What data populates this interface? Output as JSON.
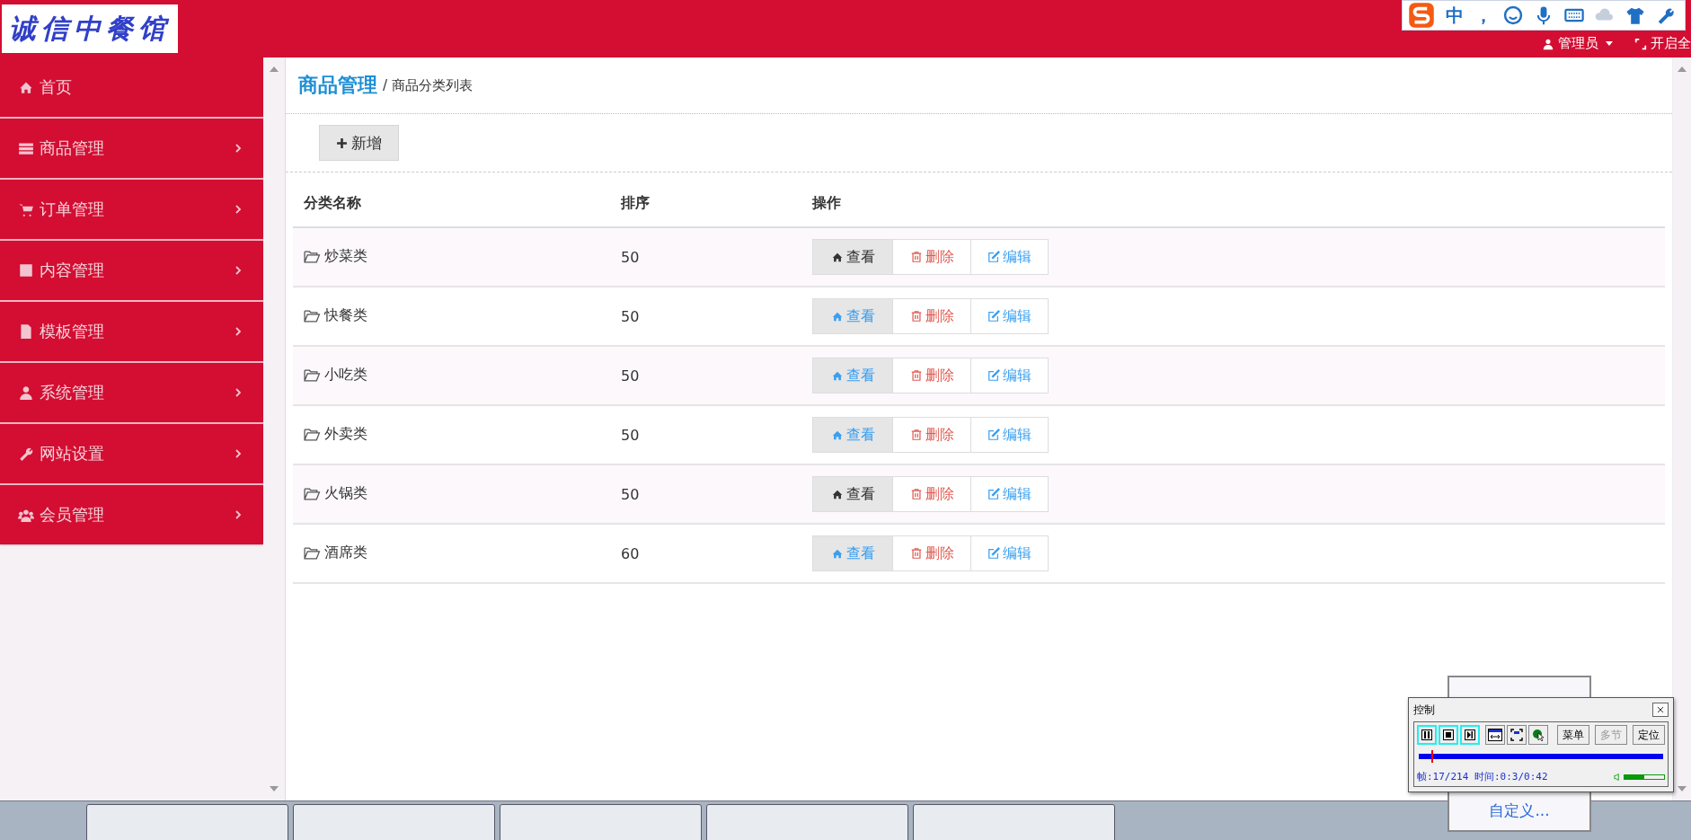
{
  "logo": "诚信中餐馆",
  "header": {
    "user": "管理员",
    "fullscreen": "开启全"
  },
  "ime": {
    "mode": "中",
    "punct": "，"
  },
  "sidebar": {
    "items": [
      {
        "label": "首页",
        "expandable": false
      },
      {
        "label": "商品管理",
        "expandable": true
      },
      {
        "label": "订单管理",
        "expandable": true
      },
      {
        "label": "内容管理",
        "expandable": true
      },
      {
        "label": "模板管理",
        "expandable": true
      },
      {
        "label": "系统管理",
        "expandable": true
      },
      {
        "label": "网站设置",
        "expandable": true
      },
      {
        "label": "会员管理",
        "expandable": true
      }
    ]
  },
  "breadcrumb": {
    "section": "商品管理",
    "page": "/ 商品分类列表"
  },
  "toolbar": {
    "add": "新增"
  },
  "table": {
    "columns": [
      "分类名称",
      "排序",
      "操作"
    ],
    "rows": [
      {
        "name": "炒菜类",
        "order": "50",
        "actions": [
          {
            "kind": "view",
            "label": "查看",
            "active": true
          },
          {
            "kind": "delete",
            "label": "删除"
          },
          {
            "kind": "edit",
            "label": "编辑"
          }
        ]
      },
      {
        "name": "快餐类",
        "order": "50",
        "actions": [
          {
            "kind": "view",
            "label": "查看",
            "active": false
          },
          {
            "kind": "delete",
            "label": "删除"
          },
          {
            "kind": "edit",
            "label": "编辑"
          }
        ]
      },
      {
        "name": "小吃类",
        "order": "50",
        "actions": [
          {
            "kind": "view",
            "label": "查看",
            "active": false
          },
          {
            "kind": "delete",
            "label": "删除"
          },
          {
            "kind": "edit",
            "label": "编辑"
          }
        ]
      },
      {
        "name": "外卖类",
        "order": "50",
        "actions": [
          {
            "kind": "view",
            "label": "查看",
            "active": false
          },
          {
            "kind": "delete",
            "label": "删除"
          },
          {
            "kind": "edit",
            "label": "编辑"
          }
        ]
      },
      {
        "name": "火锅类",
        "order": "50",
        "actions": [
          {
            "kind": "view",
            "label": "查看",
            "active": true
          },
          {
            "kind": "delete",
            "label": "删除"
          },
          {
            "kind": "edit",
            "label": "编辑"
          }
        ]
      },
      {
        "name": "酒席类",
        "order": "60",
        "actions": [
          {
            "kind": "view",
            "label": "查看",
            "active": false
          },
          {
            "kind": "delete",
            "label": "删除"
          },
          {
            "kind": "edit",
            "label": "编辑"
          }
        ]
      }
    ]
  },
  "popup": {
    "label": "自定义..."
  },
  "recorder": {
    "title": "控制",
    "buttons": [
      {
        "label": "菜单",
        "disabled": false
      },
      {
        "label": "多节",
        "disabled": true
      },
      {
        "label": "定位",
        "disabled": false
      }
    ],
    "progress": {
      "level": 0.05
    },
    "status": "帧:17/214 时间:0:3/0:42",
    "volume": {
      "level": 0.5
    }
  }
}
